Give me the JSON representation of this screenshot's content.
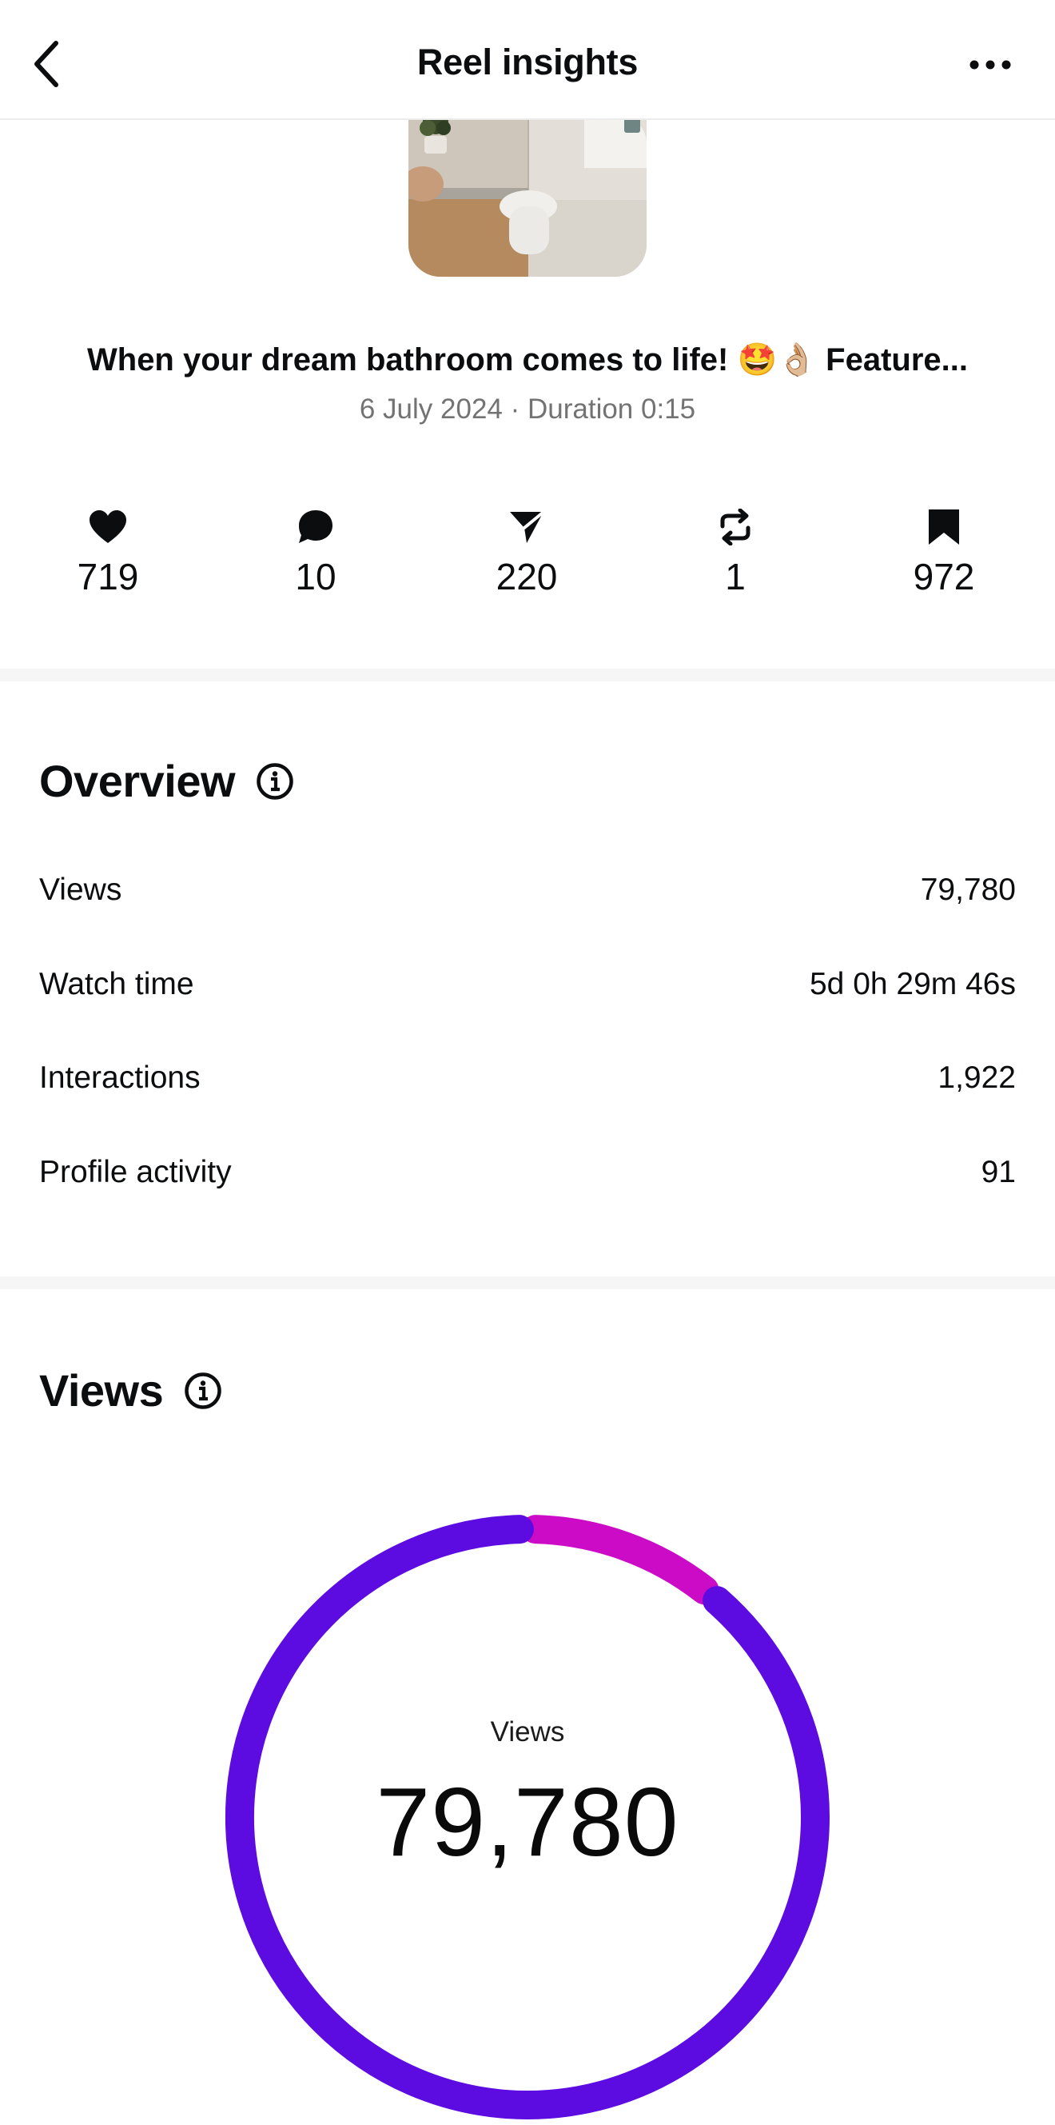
{
  "header": {
    "title": "Reel insights"
  },
  "reel": {
    "title": "When your dream bathroom comes to life! 🤩👌🏼 Feature...",
    "meta": "6 July 2024 · Duration 0:15"
  },
  "stats": [
    {
      "icon": "heart-icon",
      "value": "719"
    },
    {
      "icon": "comment-icon",
      "value": "10"
    },
    {
      "icon": "share-icon",
      "value": "220"
    },
    {
      "icon": "repost-icon",
      "value": "1"
    },
    {
      "icon": "save-icon",
      "value": "972"
    }
  ],
  "overview": {
    "title": "Overview",
    "rows": [
      {
        "label": "Views",
        "value": "79,780"
      },
      {
        "label": "Watch time",
        "value": "5d 0h 29m 46s"
      },
      {
        "label": "Interactions",
        "value": "1,922"
      },
      {
        "label": "Profile activity",
        "value": "91"
      }
    ]
  },
  "views": {
    "title": "Views",
    "donut_label": "Views",
    "donut_value": "79,780",
    "segments": [
      {
        "fraction": 0.11,
        "color": "#cc0bc6"
      },
      {
        "fraction": 0.89,
        "color": "#5c0be0"
      }
    ]
  }
}
